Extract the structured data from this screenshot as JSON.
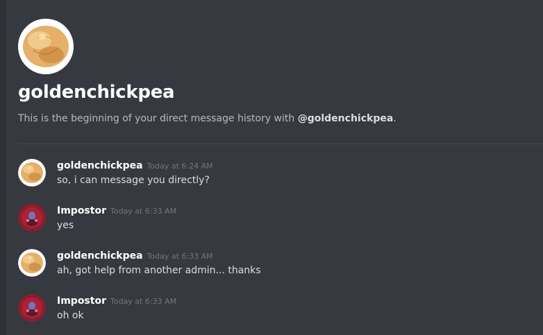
{
  "dm_header": {
    "title": "goldenchickpea",
    "intro_text": "This is the beginning of your direct message history with ",
    "intro_handle": "@goldenchickpea",
    "intro_end": "."
  },
  "colors": {
    "background": "#36393f",
    "username": "#ffffff",
    "message_text": "#dcddde",
    "timestamp": "#72767d",
    "muted_text": "#b9bbbe"
  },
  "messages": [
    {
      "author": "goldenchickpea",
      "timestamp": "Today at 6:24 AM",
      "text": "so, i can message you directly?",
      "avatar": "chickpea-avatar"
    },
    {
      "author": "Impostor",
      "timestamp": "Today at 6:33 AM",
      "text": "yes",
      "avatar": "impostor-avatar"
    },
    {
      "author": "goldenchickpea",
      "timestamp": "Today at 6:33 AM",
      "text": "ah, got help from another admin... thanks",
      "avatar": "chickpea-avatar"
    },
    {
      "author": "Impostor",
      "timestamp": "Today at 6:33 AM",
      "text": "oh ok",
      "avatar": "impostor-avatar"
    }
  ]
}
